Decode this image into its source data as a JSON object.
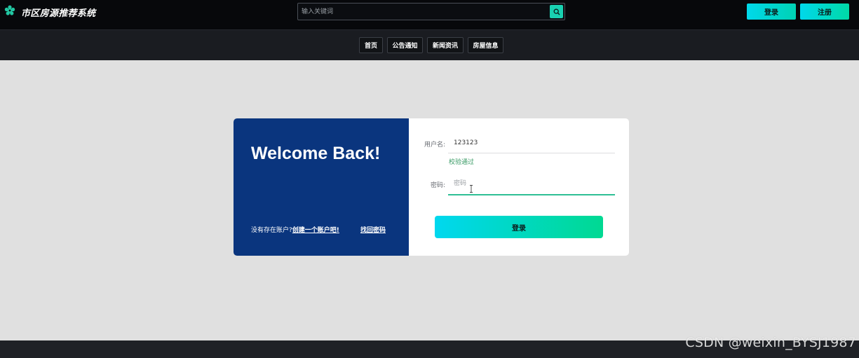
{
  "header": {
    "logo_icon": "gear-flower-icon",
    "title": "市区房源推荐系统",
    "search_placeholder": "输入关键词",
    "search_icon": "search-icon",
    "login_label": "登录",
    "register_label": "注册"
  },
  "nav": {
    "items": [
      "首页",
      "公告通知",
      "新闻资讯",
      "房屋信息"
    ]
  },
  "login_card": {
    "welcome": "Welcome Back!",
    "no_account": "没有存在账户?",
    "create_account": "创建一个账户吧!",
    "forgot_password": "找回密码",
    "username_label": "用户名:",
    "username_value": "123123",
    "validation_message": "校验通过",
    "password_label": "密码:",
    "password_placeholder": "密码",
    "submit_label": "登录"
  },
  "watermark": "CSDN @weixin_BYSJ1987",
  "colors": {
    "topbar_bg": "#07080b",
    "nav_bg": "#1a1c21",
    "accent": "#19d1b1",
    "card_left_bg": "#0a357e",
    "page_bg": "#e0e0e0",
    "valid_text": "#3a9b66"
  }
}
